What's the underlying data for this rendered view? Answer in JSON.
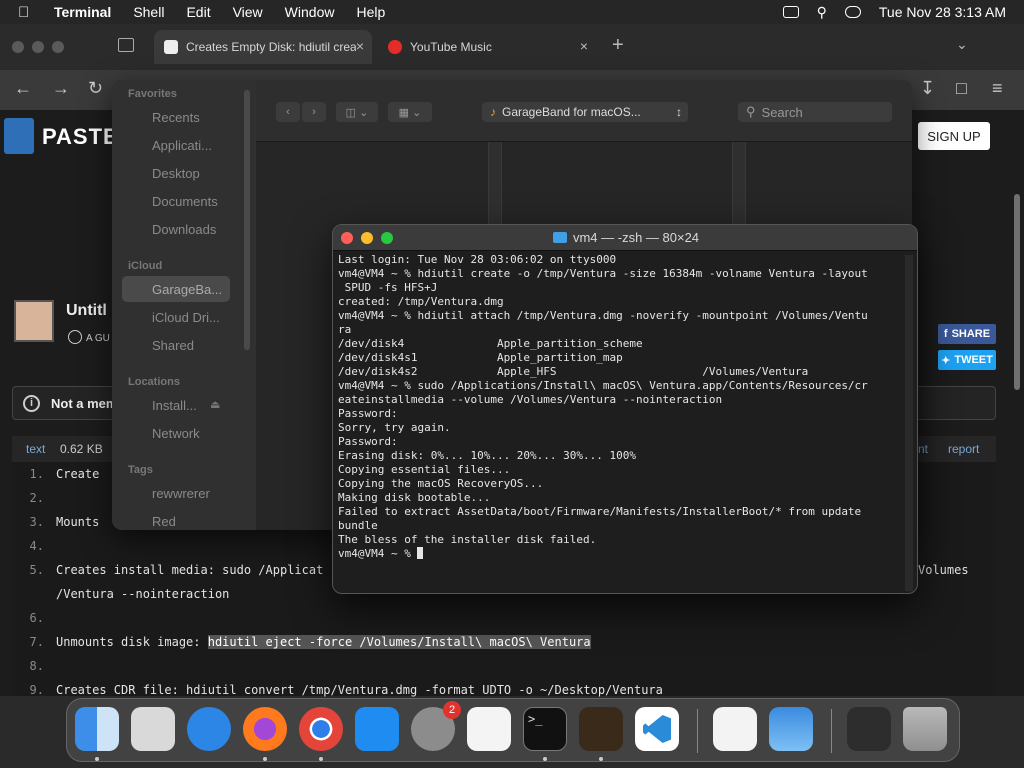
{
  "menubar": {
    "app": "Terminal",
    "items": [
      "Shell",
      "Edit",
      "View",
      "Window",
      "Help"
    ],
    "clock": "Tue Nov 28  3:13 AM"
  },
  "browser": {
    "tabs": [
      {
        "label": "Creates Empty Disk: hdiutil crea",
        "active": true
      },
      {
        "label": "YouTube Music",
        "active": false
      }
    ]
  },
  "pastebin": {
    "logo_text": "PASTE",
    "signup": "SIGN UP",
    "paste_title": "Untitl",
    "author_prefix": "A GU",
    "share": "SHARE",
    "tweet": "TWEET",
    "notice": "Not a mem",
    "meta": {
      "format": "text",
      "size": "0.62 KB",
      "right_partial": "nt",
      "report": "report"
    },
    "lines": [
      {
        "n": "1.",
        "text": "Create"
      },
      {
        "n": "2.",
        "text": ""
      },
      {
        "n": "3.",
        "text": "Mounts"
      },
      {
        "n": "4.",
        "text": ""
      },
      {
        "n": "5.",
        "text": "Creates install media: sudo /Applicat",
        "right": "Volumes"
      },
      {
        "n": "",
        "text": "/Ventura --nointeraction"
      },
      {
        "n": "6.",
        "text": ""
      },
      {
        "n": "7.",
        "text": "Unmounts disk image: ",
        "hl": "hdiutil eject -force /Volumes/Install\\ macOS\\ Ventura"
      },
      {
        "n": "8.",
        "text": ""
      },
      {
        "n": "9.",
        "text": "Creates CDR file: hdiutil convert /tmp/Ventura.dmg -format UDTO -o ~/Desktop/Ventura"
      }
    ]
  },
  "finder": {
    "favorites_head": "Favorites",
    "favorites": [
      "Recents",
      "Applicati...",
      "Desktop",
      "Documents",
      "Downloads"
    ],
    "icloud_head": "iCloud",
    "icloud": [
      "GarageBa...",
      "iCloud Dri...",
      "Shared"
    ],
    "locations_head": "Locations",
    "locations": [
      "Install...",
      "Network"
    ],
    "tags_head": "Tags",
    "tags": [
      "rewwrerer",
      "Red"
    ],
    "path_popup": "GarageBand for macOS...",
    "search_placeholder": "Search"
  },
  "terminal": {
    "title": "vm4 — -zsh — 80×24",
    "lines": [
      "Last login: Tue Nov 28 03:06:02 on ttys000",
      "vm4@VM4 ~ % hdiutil create -o /tmp/Ventura -size 16384m -volname Ventura -layout",
      " SPUD -fs HFS+J",
      "created: /tmp/Ventura.dmg",
      "vm4@VM4 ~ % hdiutil attach /tmp/Ventura.dmg -noverify -mountpoint /Volumes/Ventu",
      "ra",
      "/dev/disk4              Apple_partition_scheme",
      "/dev/disk4s1            Apple_partition_map",
      "/dev/disk4s2            Apple_HFS                      /Volumes/Ventura",
      "vm4@VM4 ~ % sudo /Applications/Install\\ macOS\\ Ventura.app/Contents/Resources/cr",
      "eateinstallmedia --volume /Volumes/Ventura --nointeraction",
      "Password:",
      "Sorry, try again.",
      "Password:",
      "Erasing disk: 0%... 10%... 20%... 30%... 100%",
      "Copying essential files...",
      "Copying the macOS RecoveryOS...",
      "Making disk bootable...",
      "Failed to extract AssetData/boot/Firmware/Manifests/InstallerBoot/* from update",
      "bundle",
      "The bless of the installer disk failed."
    ],
    "prompt": "vm4@VM4 ~ % "
  },
  "dock": {
    "apps": [
      "Finder",
      "Launchpad",
      "Safari",
      "Firefox",
      "Chrome",
      "App Store",
      "System Settings",
      "TextEdit",
      "Terminal",
      "GarageBand",
      "VS Code",
      "Visual Studio",
      "Weather",
      "Downloads",
      "Trash"
    ],
    "settings_badge": "2"
  }
}
